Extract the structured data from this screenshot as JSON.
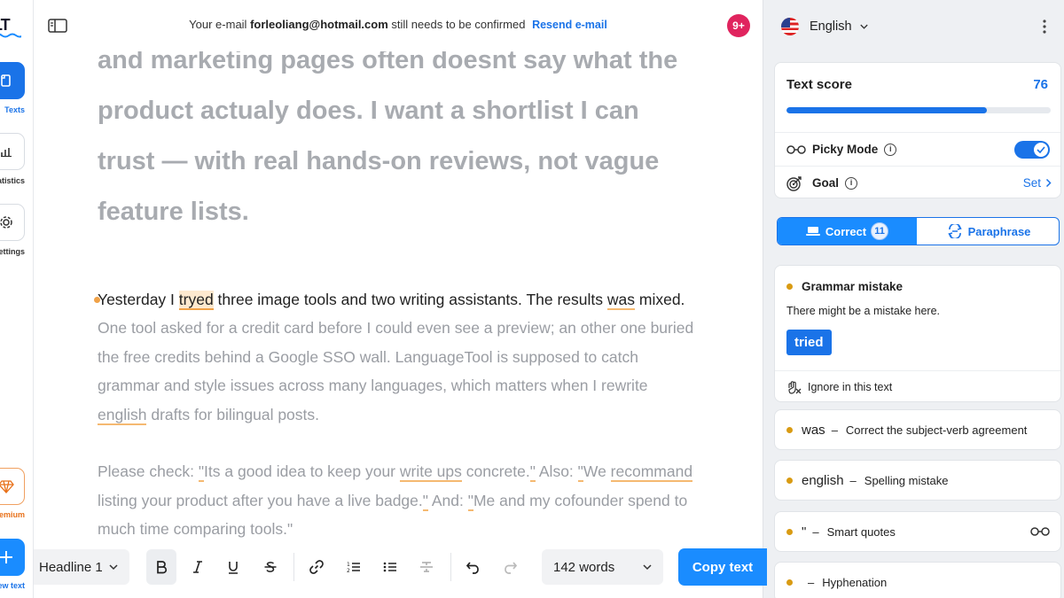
{
  "rail": {
    "logo": "LT",
    "items": [
      {
        "label": "Texts"
      },
      {
        "label": "Statistics"
      },
      {
        "label": "Settings"
      }
    ],
    "premium_label": "Premium",
    "new_text_label": "New text"
  },
  "topbar": {
    "notice_prefix": "Your e-mail",
    "email": "forleoliang@hotmail.com",
    "notice_suffix": "still needs to be confirmed",
    "resend_label": "Resend e-mail",
    "notifications": "9+"
  },
  "editor": {
    "headline": "and marketing pages often doesnt say what the product actualy does. I want a shortlist I can trust — with real hands-on reviews, not vague feature lists.",
    "p1": {
      "a": "Yesterday I ",
      "err1": "tryed",
      "b": " three image tools and two writing assistants. The results ",
      "err2": "was",
      "c": " mixed."
    },
    "p2": {
      "a": "One tool asked for a credit card before I could even see a preview; an other one buried the free credits behind a Google SSO wall. LanguageTool is supposed to catch grammar and style issues across many languages, which matters when I rewrite ",
      "err": "english",
      "b": " drafts for bilingual posts."
    },
    "p3": {
      "a": "Please check: ",
      "q1": "\"",
      "b": "Its a good idea to keep your ",
      "err1": "write ups",
      "c": " concrete.",
      "q2": "\"",
      "d": " Also: ",
      "q3": "\"",
      "e": "We ",
      "err2": "recommand",
      "f": " listing your product after you have a live badge.",
      "q4": "\"",
      "g": " And: ",
      "q5": "\"",
      "h": "Me and my cofounder spend to much time comparing tools.",
      "q6": "\""
    }
  },
  "toolbar": {
    "style": "Headline 1",
    "word_count": "142 words",
    "copy_label": "Copy text"
  },
  "panel": {
    "language": "English",
    "score_title": "Text score",
    "score_value": "76",
    "score_fraction": 0.76,
    "picky_label": "Picky Mode",
    "picky_on": true,
    "goal_label": "Goal",
    "goal_action": "Set",
    "tabs": {
      "correct_label": "Correct",
      "correct_count": "11",
      "paraphrase_label": "Paraphrase"
    },
    "active_issue": {
      "title": "Grammar mistake",
      "message": "There might be a mistake here.",
      "suggestion": "tried",
      "ignore_label": "Ignore in this text"
    },
    "issues": [
      {
        "word": "was",
        "desc": "Correct the subject-verb agreement"
      },
      {
        "word": "english",
        "desc": "Spelling mistake"
      },
      {
        "word": "\"",
        "desc": "Smart quotes"
      },
      {
        "word": "",
        "desc": "Hyphenation"
      }
    ],
    "colors": {
      "accent": "#1a73e8",
      "issue_dot": "#d99b13",
      "underline": "#f5b971"
    }
  }
}
